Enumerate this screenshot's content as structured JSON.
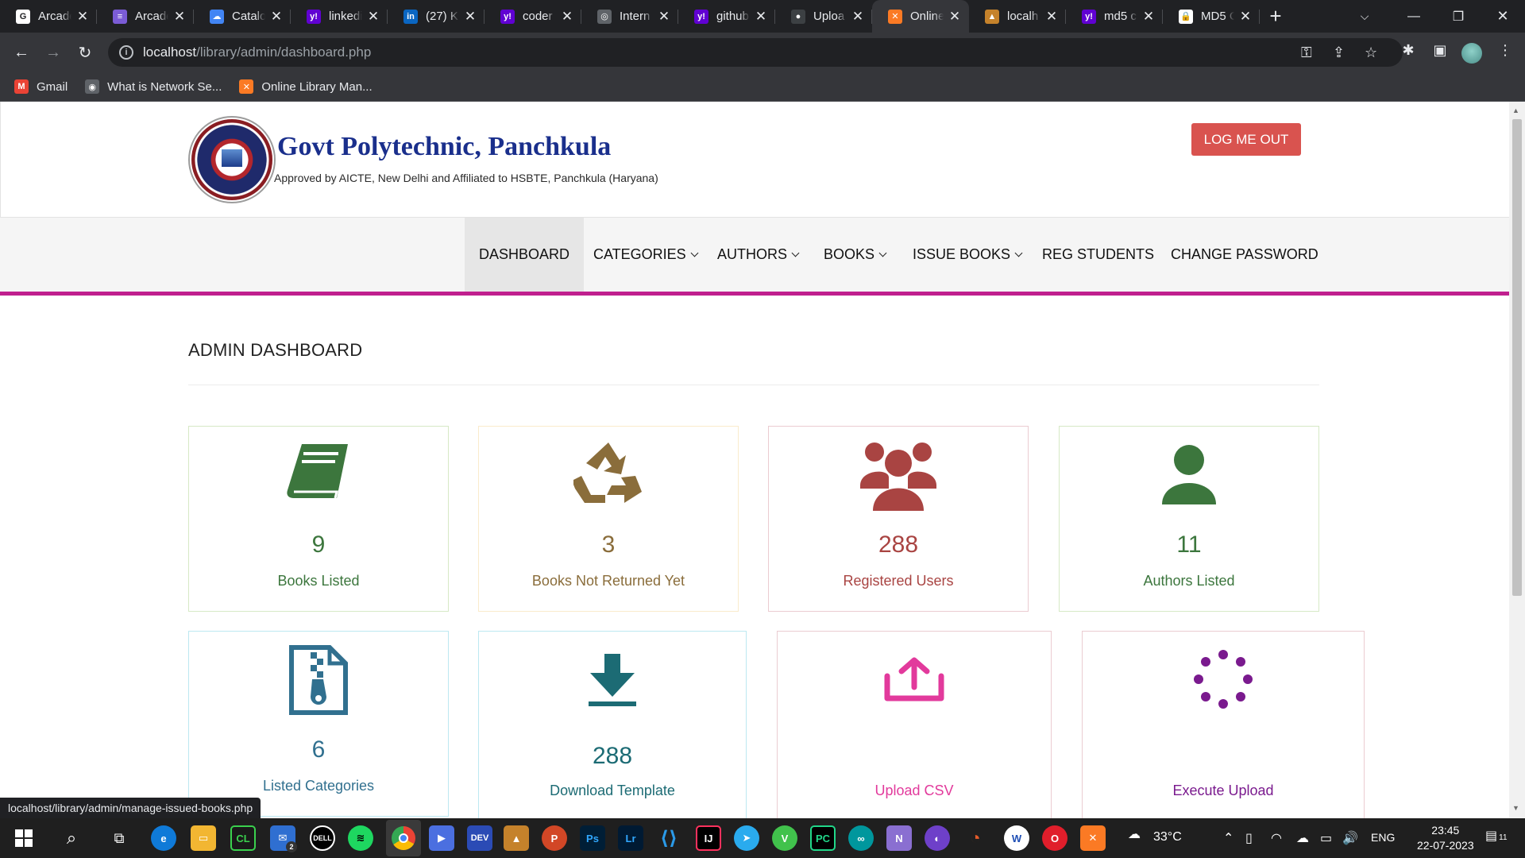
{
  "browser": {
    "tabs": [
      {
        "title": "Arcade",
        "fav": "G",
        "color": "#ffffff"
      },
      {
        "title": "Arcade",
        "fav": "≡",
        "color": "#7b5cd6"
      },
      {
        "title": "Catalog",
        "fav": "☁",
        "color": "#4285f4"
      },
      {
        "title": "linkedin",
        "fav": "y!",
        "color": "#6001d2"
      },
      {
        "title": "(27) K",
        "fav": "in",
        "color": "#0a66c2"
      },
      {
        "title": "coder",
        "fav": "y!",
        "color": "#6001d2"
      },
      {
        "title": "Intern",
        "fav": "◎",
        "color": "#5f6368"
      },
      {
        "title": "github",
        "fav": "y!",
        "color": "#6001d2"
      },
      {
        "title": "Uploa",
        "fav": "●",
        "color": "#3c4043"
      },
      {
        "title": "Online",
        "fav": "✕",
        "color": "#fb7a24"
      },
      {
        "title": "localh",
        "fav": "▲",
        "color": "#c5822b"
      },
      {
        "title": "md5 c",
        "fav": "y!",
        "color": "#6001d2"
      },
      {
        "title": "MD5 C",
        "fav": "🔒",
        "color": "#ffffff"
      }
    ],
    "url_host": "localhost",
    "url_path": "/library/admin/dashboard.php",
    "bookmarks": [
      {
        "label": "Gmail",
        "icon": "M",
        "color": "#ea4335"
      },
      {
        "label": "What is Network Se...",
        "icon": "◉",
        "color": "#5f6368"
      },
      {
        "label": "Online Library Man...",
        "icon": "✕",
        "color": "#fb7a24"
      }
    ],
    "status_url": "localhost/library/admin/manage-issued-books.php"
  },
  "header": {
    "college_name": "Govt Polytechnic, Panchkula",
    "college_sub": "Approved by AICTE, New Delhi and Affiliated to HSBTE, Panchkula (Haryana)",
    "logout": "LOG ME OUT"
  },
  "menu": {
    "items": [
      {
        "label": "DASHBOARD"
      },
      {
        "label": "CATEGORIES"
      },
      {
        "label": "AUTHORS"
      },
      {
        "label": "BOOKS"
      },
      {
        "label": "ISSUE BOOKS"
      },
      {
        "label": "REG STUDENTS"
      },
      {
        "label": "CHANGE PASSWORD"
      }
    ]
  },
  "page": {
    "title": "ADMIN DASHBOARD"
  },
  "cards": [
    {
      "value": "9",
      "label": "Books Listed",
      "icon": "book-icon",
      "color": "#3c763d",
      "border": "#d6e9c6"
    },
    {
      "value": "3",
      "label": "Books Not Returned Yet",
      "icon": "recycle-icon",
      "color": "#8a6d3b",
      "border": "#faebcc"
    },
    {
      "value": "288",
      "label": "Registered Users",
      "icon": "users-icon",
      "color": "#a94442",
      "border": "#ebccd1"
    },
    {
      "value": "11",
      "label": "Authors Listed",
      "icon": "user-icon",
      "color": "#3c763d",
      "border": "#d6e9c6"
    },
    {
      "value": "6",
      "label": "Listed Categories",
      "icon": "file-archive-icon",
      "color": "#31708f",
      "border": "#bce8f1"
    },
    {
      "value": "288",
      "label": "Download Template",
      "icon": "download-icon",
      "color": "#1c6b74",
      "border": "#bce8f1"
    },
    {
      "value": "",
      "label": "Upload CSV",
      "icon": "upload-icon",
      "color": "#e23a9c",
      "border": "#ebccd1"
    },
    {
      "value": "",
      "label": "Execute Upload",
      "icon": "spinner-icon",
      "color": "#7a1a8e",
      "border": "#ebccd1"
    }
  ],
  "taskbar": {
    "weather": "33°C",
    "language": "ENG",
    "time": "23:45",
    "date": "22-07-2023",
    "notification_count": "11",
    "mail_badge": "2"
  }
}
